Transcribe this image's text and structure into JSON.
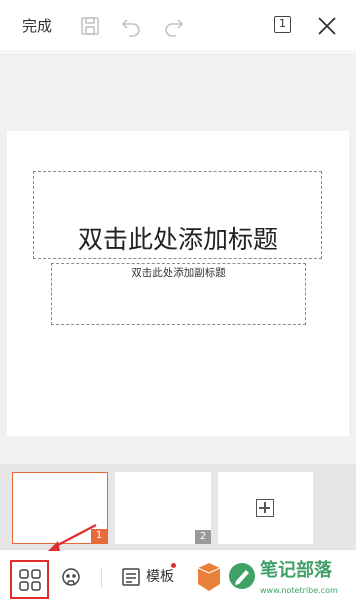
{
  "topbar": {
    "done_label": "完成",
    "page_count": "1"
  },
  "slide": {
    "title_placeholder": "双击此处添加标题",
    "subtitle_placeholder": "双击此处添加副标题"
  },
  "thumbnails": [
    {
      "number": "1",
      "active": true
    },
    {
      "number": "2",
      "active": false
    }
  ],
  "bottombar": {
    "template_label": "模板"
  },
  "watermark": {
    "title": "笔记部落",
    "url": "www.notetribe.com"
  },
  "colors": {
    "accent": "#e86a3a",
    "highlight_red": "#e02d2d",
    "canvas_bg": "#f1f1f1",
    "watermark_green": "#2f9a5a"
  },
  "icons": [
    "save-icon",
    "undo-icon",
    "redo-icon",
    "close-icon",
    "thumbnail-grid-icon",
    "emoji-icon",
    "template-icon",
    "add-slide-icon"
  ]
}
